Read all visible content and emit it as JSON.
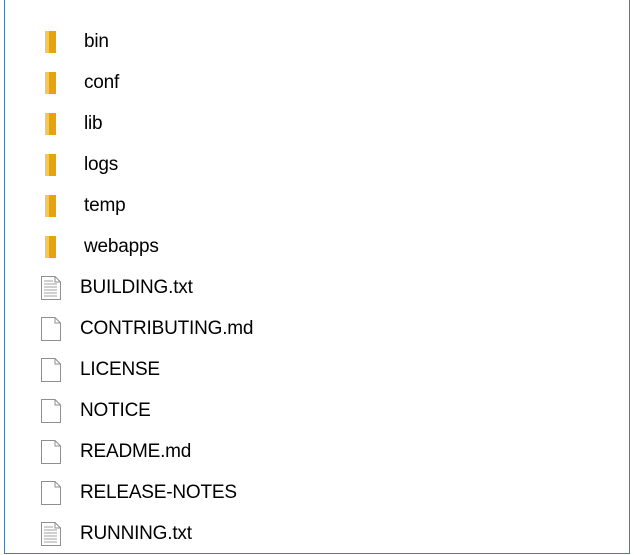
{
  "items": [
    {
      "name": "bin",
      "icon": "folder-icon",
      "kind": "folder"
    },
    {
      "name": "conf",
      "icon": "folder-icon",
      "kind": "folder"
    },
    {
      "name": "lib",
      "icon": "folder-icon",
      "kind": "folder"
    },
    {
      "name": "logs",
      "icon": "folder-icon",
      "kind": "folder"
    },
    {
      "name": "temp",
      "icon": "folder-icon",
      "kind": "folder"
    },
    {
      "name": "webapps",
      "icon": "folder-icon",
      "kind": "folder"
    },
    {
      "name": "BUILDING.txt",
      "icon": "text-file-icon",
      "kind": "text"
    },
    {
      "name": "CONTRIBUTING.md",
      "icon": "blank-file-icon",
      "kind": "file"
    },
    {
      "name": "LICENSE",
      "icon": "blank-file-icon",
      "kind": "file"
    },
    {
      "name": "NOTICE",
      "icon": "blank-file-icon",
      "kind": "file"
    },
    {
      "name": "README.md",
      "icon": "blank-file-icon",
      "kind": "file"
    },
    {
      "name": "RELEASE-NOTES",
      "icon": "blank-file-icon",
      "kind": "file"
    },
    {
      "name": "RUNNING.txt",
      "icon": "text-file-icon",
      "kind": "text"
    }
  ],
  "colors": {
    "folder": "#e8a10f",
    "folder_light": "#f7c84a",
    "file_border": "#8f8f8f",
    "text_lines": "#a0a0a0",
    "frame_border": "#4a78b0"
  }
}
